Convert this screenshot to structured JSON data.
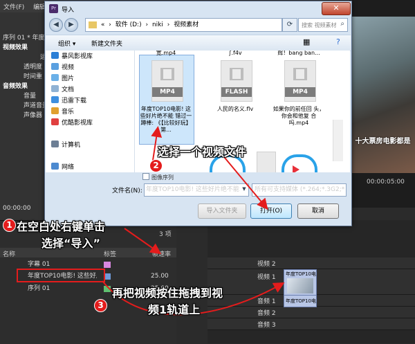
{
  "premiere": {
    "menu": [
      "文件(F)",
      "编辑(E)"
    ],
    "left_panel": {
      "sequence_label": "序列 01 * 年度",
      "items": [
        {
          "label": "视频效果",
          "head": true
        },
        {
          "label": "运",
          "head": false
        },
        {
          "label": "透明度",
          "head": false
        },
        {
          "label": "时间重",
          "head": false
        },
        {
          "label": "音频效果",
          "head": true
        },
        {
          "label": "音量",
          "head": false
        },
        {
          "label": "声道音量",
          "head": false
        },
        {
          "label": "声像器",
          "head": false
        }
      ],
      "timecode": "00:00:00"
    },
    "monitor": {
      "caption": "十大票房电影都是",
      "timecode": "00:00:05:00"
    },
    "project": {
      "item_count": "3 项",
      "columns": {
        "name": "名称",
        "label": "标签",
        "fps": "帧速率"
      },
      "items": [
        {
          "name": "字幕 01",
          "color": "#d987e0",
          "fps": ""
        },
        {
          "name": "年度TOP10电影! 这些好片",
          "color": "#6f9ad8",
          "fps": "25.00"
        },
        {
          "name": "序列 01",
          "color": "#5fc070",
          "fps": "25.00"
        }
      ]
    },
    "timeline": {
      "tracks": [
        "视频 2",
        "视频 1",
        "音频 1",
        "音频 2",
        "音频 3"
      ],
      "clip_label": "年度TOP10电影!",
      "audio_clip_label": "年度TOP10电影"
    }
  },
  "dialog": {
    "title": "导入",
    "app_icon": "Pr",
    "breadcrumb": [
      "«",
      "软件 (D:)",
      "niki",
      "视频素材"
    ],
    "search_placeholder": "搜索 视频素材",
    "toolbar": {
      "organize": "组织 ▾",
      "new_folder": "新建文件夹"
    },
    "nav_items": [
      {
        "label": "暴风影视库",
        "color": "#2b7fd6"
      },
      {
        "label": "视频",
        "color": "#5aa0e0"
      },
      {
        "label": "图片",
        "color": "#6ab0e8"
      },
      {
        "label": "文档",
        "color": "#8fb2d4"
      },
      {
        "label": "迅雷下载",
        "color": "#3d8fe0"
      },
      {
        "label": "音乐",
        "color": "#e0a030"
      },
      {
        "label": "优酷影视库",
        "color": "#e04040"
      },
      {
        "label": "计算机",
        "color": "#6d7f95"
      },
      {
        "label": "网络",
        "color": "#4d8ad0"
      }
    ],
    "files": [
      {
        "top_name": "宽.mp4",
        "badge": "MP4",
        "name": "年度TOP10电影! 这些好片绝不能 错过一蹲棒: 《【比较好玩】第...",
        "selected": true
      },
      {
        "top_name": "∫.f4v",
        "badge": "FLASH",
        "name": "人民的名义.flv",
        "selected": false
      },
      {
        "top_name": "辉！bang ban...",
        "badge": "MP4",
        "name": "如果你的前任回 头，你会和他复 合吗.mp4",
        "selected": false
      }
    ],
    "preview_label": "图像序列",
    "filename_label": "文件名(N):",
    "filename_value": "年度TOP10电影! 这些好片绝不能",
    "filter_value": "所有可支持媒体 (*.264;*.3G2;*",
    "buttons": {
      "import_folder": "导入文件夹",
      "open": "打开(O)",
      "cancel": "取消"
    }
  },
  "annotations": {
    "step1_line1": "在空白处右键单击",
    "step1_line2": "选择“导入”",
    "step2": "选择一个视频文件",
    "step3_line1": "再把视频按住拖拽到视",
    "step3_line2": "频1轨道上",
    "numbers": [
      "1",
      "2",
      "3"
    ]
  },
  "colors": {
    "accent": "#e41c1c",
    "selection": "#cde6fb"
  }
}
